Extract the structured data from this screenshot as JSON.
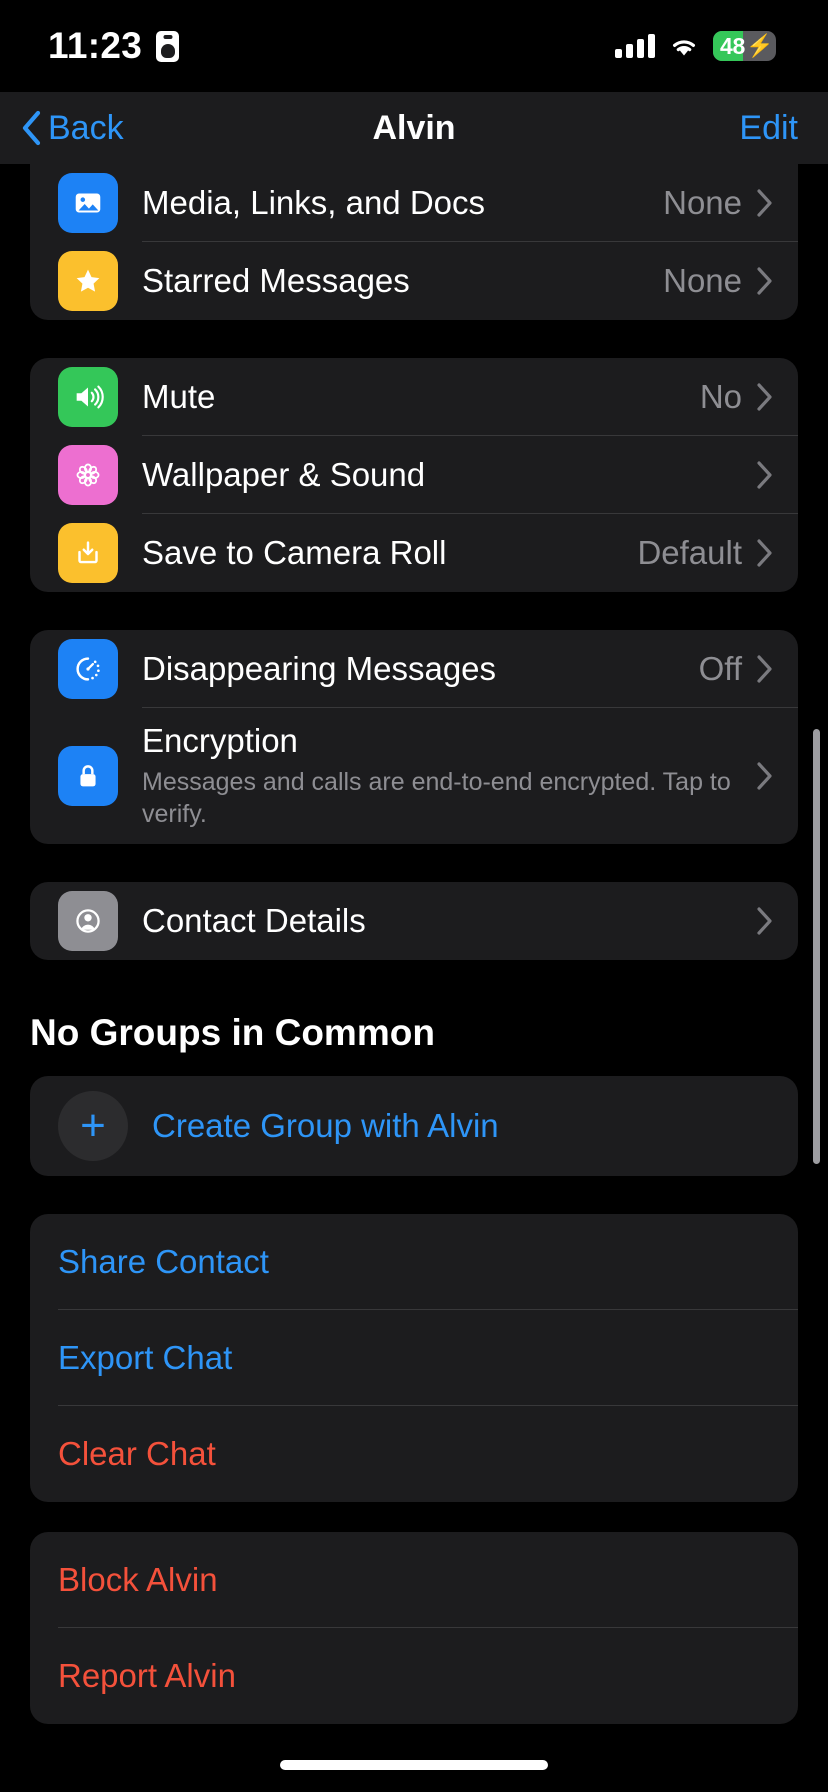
{
  "status_bar": {
    "time": "11:23",
    "recording_icon": "screen-record-icon",
    "battery_percent": "48",
    "battery_charging": true,
    "battery_color": "#35c759",
    "signal_bars": 4
  },
  "nav": {
    "back_label": "Back",
    "title": "Alvin",
    "edit_label": "Edit"
  },
  "sections": {
    "media": {
      "rows": [
        {
          "label": "Media, Links, and Docs",
          "value": "None",
          "icon": "photo-icon",
          "icon_color": "#1d82f5"
        },
        {
          "label": "Starred Messages",
          "value": "None",
          "icon": "star-icon",
          "icon_color": "#fbc02d"
        }
      ]
    },
    "chat_settings": {
      "rows": [
        {
          "label": "Mute",
          "value": "No",
          "icon": "speaker-icon",
          "icon_color": "#34c759"
        },
        {
          "label": "Wallpaper & Sound",
          "value": "",
          "icon": "flower-icon",
          "icon_color": "#ed6fd0"
        },
        {
          "label": "Save to Camera Roll",
          "value": "Default",
          "icon": "download-icon",
          "icon_color": "#fbc02d"
        }
      ]
    },
    "privacy": {
      "disappearing": {
        "label": "Disappearing Messages",
        "value": "Off",
        "icon": "timer-icon",
        "icon_color": "#1d82f5"
      },
      "encryption": {
        "label": "Encryption",
        "sub": "Messages and calls are end-to-end encrypted. Tap to verify.",
        "icon": "lock-icon",
        "icon_color": "#1d82f5"
      }
    },
    "contact": {
      "rows": [
        {
          "label": "Contact Details",
          "value": "",
          "icon": "person-circle-icon",
          "icon_color": "#8e8e93"
        }
      ]
    },
    "groups": {
      "header": "No Groups in Common",
      "create_label": "Create Group with Alvin",
      "create_icon": "plus-icon"
    },
    "actions": {
      "items": [
        {
          "label": "Share Contact",
          "style": "blue"
        },
        {
          "label": "Export Chat",
          "style": "blue"
        },
        {
          "label": "Clear Chat",
          "style": "red"
        }
      ]
    },
    "danger": {
      "items": [
        {
          "label": "Block Alvin",
          "style": "red"
        },
        {
          "label": "Report Alvin",
          "style": "red"
        }
      ]
    }
  },
  "colors": {
    "accent_blue": "#2e95f7",
    "destructive_red": "#f4513b",
    "card_bg": "#1c1c1e",
    "page_bg": "#000000",
    "secondary_text": "#8e8e93"
  }
}
